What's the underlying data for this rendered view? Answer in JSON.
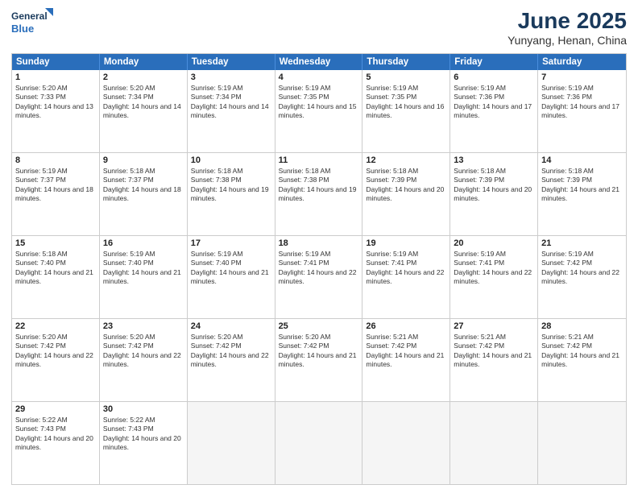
{
  "logo": {
    "line1": "General",
    "line2": "Blue",
    "triangle_color": "#2a6ebb"
  },
  "title": "June 2025",
  "subtitle": "Yunyang, Henan, China",
  "header_days": [
    "Sunday",
    "Monday",
    "Tuesday",
    "Wednesday",
    "Thursday",
    "Friday",
    "Saturday"
  ],
  "weeks": [
    [
      {
        "day": "1",
        "sunrise": "Sunrise: 5:20 AM",
        "sunset": "Sunset: 7:33 PM",
        "daylight": "Daylight: 14 hours and 13 minutes."
      },
      {
        "day": "2",
        "sunrise": "Sunrise: 5:20 AM",
        "sunset": "Sunset: 7:34 PM",
        "daylight": "Daylight: 14 hours and 14 minutes."
      },
      {
        "day": "3",
        "sunrise": "Sunrise: 5:19 AM",
        "sunset": "Sunset: 7:34 PM",
        "daylight": "Daylight: 14 hours and 14 minutes."
      },
      {
        "day": "4",
        "sunrise": "Sunrise: 5:19 AM",
        "sunset": "Sunset: 7:35 PM",
        "daylight": "Daylight: 14 hours and 15 minutes."
      },
      {
        "day": "5",
        "sunrise": "Sunrise: 5:19 AM",
        "sunset": "Sunset: 7:35 PM",
        "daylight": "Daylight: 14 hours and 16 minutes."
      },
      {
        "day": "6",
        "sunrise": "Sunrise: 5:19 AM",
        "sunset": "Sunset: 7:36 PM",
        "daylight": "Daylight: 14 hours and 17 minutes."
      },
      {
        "day": "7",
        "sunrise": "Sunrise: 5:19 AM",
        "sunset": "Sunset: 7:36 PM",
        "daylight": "Daylight: 14 hours and 17 minutes."
      }
    ],
    [
      {
        "day": "8",
        "sunrise": "Sunrise: 5:19 AM",
        "sunset": "Sunset: 7:37 PM",
        "daylight": "Daylight: 14 hours and 18 minutes."
      },
      {
        "day": "9",
        "sunrise": "Sunrise: 5:18 AM",
        "sunset": "Sunset: 7:37 PM",
        "daylight": "Daylight: 14 hours and 18 minutes."
      },
      {
        "day": "10",
        "sunrise": "Sunrise: 5:18 AM",
        "sunset": "Sunset: 7:38 PM",
        "daylight": "Daylight: 14 hours and 19 minutes."
      },
      {
        "day": "11",
        "sunrise": "Sunrise: 5:18 AM",
        "sunset": "Sunset: 7:38 PM",
        "daylight": "Daylight: 14 hours and 19 minutes."
      },
      {
        "day": "12",
        "sunrise": "Sunrise: 5:18 AM",
        "sunset": "Sunset: 7:39 PM",
        "daylight": "Daylight: 14 hours and 20 minutes."
      },
      {
        "day": "13",
        "sunrise": "Sunrise: 5:18 AM",
        "sunset": "Sunset: 7:39 PM",
        "daylight": "Daylight: 14 hours and 20 minutes."
      },
      {
        "day": "14",
        "sunrise": "Sunrise: 5:18 AM",
        "sunset": "Sunset: 7:39 PM",
        "daylight": "Daylight: 14 hours and 21 minutes."
      }
    ],
    [
      {
        "day": "15",
        "sunrise": "Sunrise: 5:18 AM",
        "sunset": "Sunset: 7:40 PM",
        "daylight": "Daylight: 14 hours and 21 minutes."
      },
      {
        "day": "16",
        "sunrise": "Sunrise: 5:19 AM",
        "sunset": "Sunset: 7:40 PM",
        "daylight": "Daylight: 14 hours and 21 minutes."
      },
      {
        "day": "17",
        "sunrise": "Sunrise: 5:19 AM",
        "sunset": "Sunset: 7:40 PM",
        "daylight": "Daylight: 14 hours and 21 minutes."
      },
      {
        "day": "18",
        "sunrise": "Sunrise: 5:19 AM",
        "sunset": "Sunset: 7:41 PM",
        "daylight": "Daylight: 14 hours and 22 minutes."
      },
      {
        "day": "19",
        "sunrise": "Sunrise: 5:19 AM",
        "sunset": "Sunset: 7:41 PM",
        "daylight": "Daylight: 14 hours and 22 minutes."
      },
      {
        "day": "20",
        "sunrise": "Sunrise: 5:19 AM",
        "sunset": "Sunset: 7:41 PM",
        "daylight": "Daylight: 14 hours and 22 minutes."
      },
      {
        "day": "21",
        "sunrise": "Sunrise: 5:19 AM",
        "sunset": "Sunset: 7:42 PM",
        "daylight": "Daylight: 14 hours and 22 minutes."
      }
    ],
    [
      {
        "day": "22",
        "sunrise": "Sunrise: 5:20 AM",
        "sunset": "Sunset: 7:42 PM",
        "daylight": "Daylight: 14 hours and 22 minutes."
      },
      {
        "day": "23",
        "sunrise": "Sunrise: 5:20 AM",
        "sunset": "Sunset: 7:42 PM",
        "daylight": "Daylight: 14 hours and 22 minutes."
      },
      {
        "day": "24",
        "sunrise": "Sunrise: 5:20 AM",
        "sunset": "Sunset: 7:42 PM",
        "daylight": "Daylight: 14 hours and 22 minutes."
      },
      {
        "day": "25",
        "sunrise": "Sunrise: 5:20 AM",
        "sunset": "Sunset: 7:42 PM",
        "daylight": "Daylight: 14 hours and 21 minutes."
      },
      {
        "day": "26",
        "sunrise": "Sunrise: 5:21 AM",
        "sunset": "Sunset: 7:42 PM",
        "daylight": "Daylight: 14 hours and 21 minutes."
      },
      {
        "day": "27",
        "sunrise": "Sunrise: 5:21 AM",
        "sunset": "Sunset: 7:42 PM",
        "daylight": "Daylight: 14 hours and 21 minutes."
      },
      {
        "day": "28",
        "sunrise": "Sunrise: 5:21 AM",
        "sunset": "Sunset: 7:42 PM",
        "daylight": "Daylight: 14 hours and 21 minutes."
      }
    ],
    [
      {
        "day": "29",
        "sunrise": "Sunrise: 5:22 AM",
        "sunset": "Sunset: 7:43 PM",
        "daylight": "Daylight: 14 hours and 20 minutes."
      },
      {
        "day": "30",
        "sunrise": "Sunrise: 5:22 AM",
        "sunset": "Sunset: 7:43 PM",
        "daylight": "Daylight: 14 hours and 20 minutes."
      },
      null,
      null,
      null,
      null,
      null
    ]
  ]
}
